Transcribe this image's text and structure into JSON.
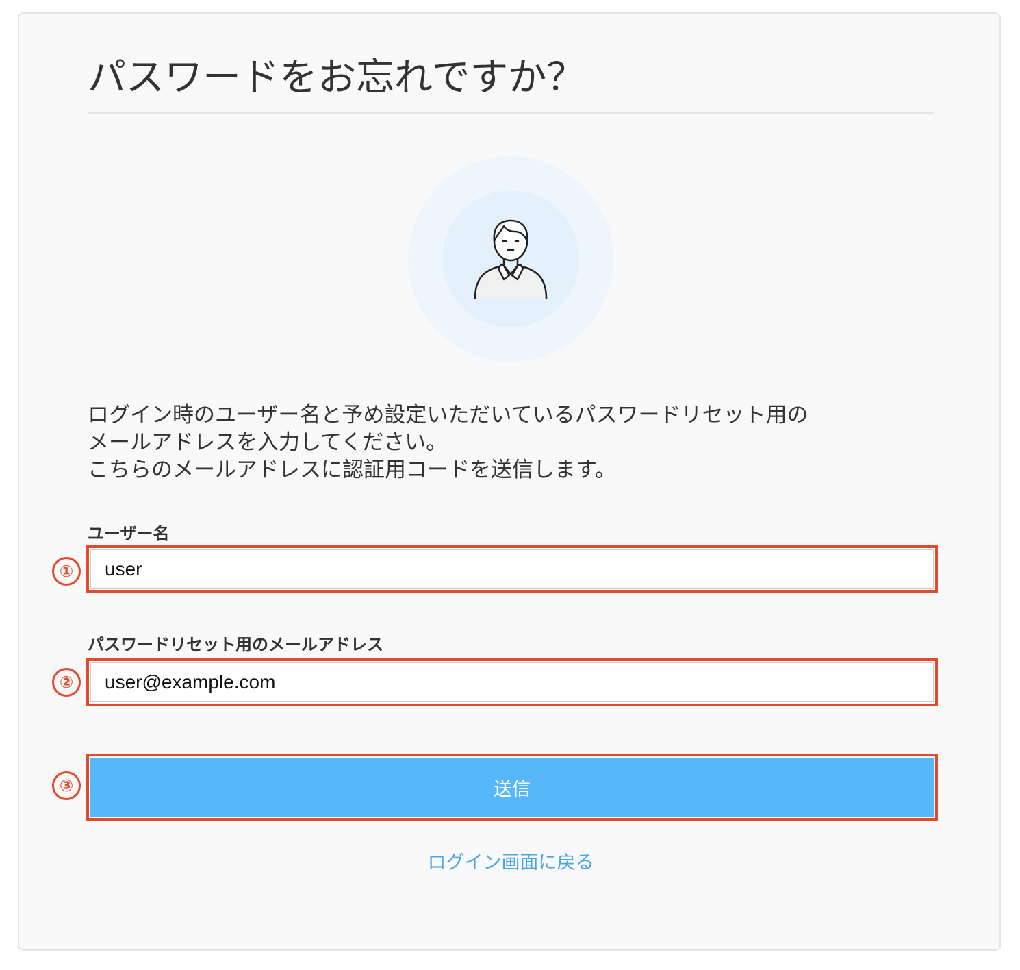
{
  "page": {
    "title": "パスワードをお忘れですか？"
  },
  "avatar": {
    "icon": "user-avatar-icon"
  },
  "description": {
    "lines": [
      "ログイン時のユーザー名と予め設定いただいているパスワードリセット用の",
      "メールアドレスを入力してください。",
      "こちらのメールアドレスに認証用コードを送信します。"
    ]
  },
  "form": {
    "username": {
      "label": "ユーザー名",
      "value": "user",
      "marker": "①"
    },
    "email": {
      "label": "パスワードリセット用のメールアドレス",
      "value": "user@example.com",
      "marker": "②"
    },
    "submit": {
      "label": "送信",
      "marker": "③"
    }
  },
  "links": {
    "back_to_login": "ログイン画面に戻る"
  },
  "colors": {
    "accent": "#56b8f8",
    "link": "#4aa6e8",
    "annotation": "#e24a2c"
  }
}
